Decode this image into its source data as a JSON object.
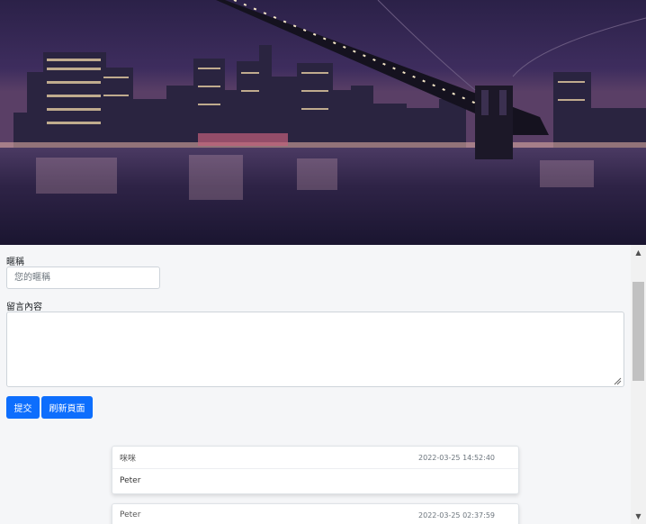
{
  "form": {
    "nickname_label": "暱稱",
    "nickname_placeholder": "您的暱稱",
    "message_label": "留言內容",
    "submit_label": "提交",
    "refresh_label": "刷新頁面"
  },
  "messages": [
    {
      "name": "咪咪",
      "time": "2022-03-25 14:52:40",
      "content": "Peter"
    },
    {
      "name": "Peter",
      "time": "2022-03-25 02:37:59",
      "content": ""
    }
  ],
  "colors": {
    "primary": "#0d6efd",
    "page_bg": "#f5f6f8"
  },
  "hero": {
    "alt": "city skyline at night with bridge"
  }
}
